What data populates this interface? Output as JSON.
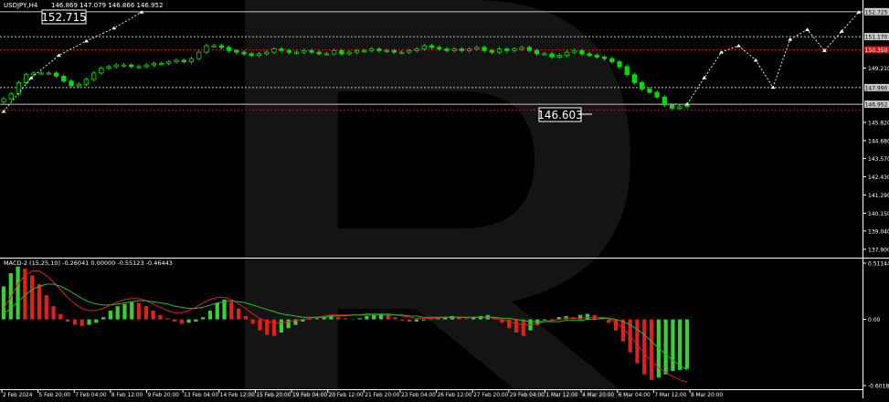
{
  "header": {
    "symbol": "USDJPY,H4",
    "ohlc": "146.869 147.079 146.866 146.952",
    "macd_label": "MACD-2 (15,25,10) -0.26041 0.00000 -0.55123 -0.46443"
  },
  "watermark": "R",
  "colors": {
    "background": "#000000",
    "candle": "#00e000",
    "hist_up": "#38d038",
    "hist_down": "#e02020",
    "macd_line": "#e02020",
    "signal_line": "#20c020",
    "level_white": "#c8c8c8",
    "level_red": "#d01010",
    "forecast": "#ffffff"
  },
  "callouts": {
    "high": "152.715",
    "current": "146.603"
  },
  "chart_data": [
    {
      "type": "line",
      "title": "USDJPY,H4",
      "ylim": [
        137.49,
        153.0
      ],
      "x_ticks": [
        "2 Feb 2024",
        "5 Feb 20:00",
        "7 Feb 04:00",
        "8 Feb 12:00",
        "9 Feb 20:00",
        "13 Feb 04:00",
        "14 Feb 12:00",
        "15 Feb 20:00",
        "19 Feb 04:00",
        "20 Feb 12:00",
        "21 Feb 20:00",
        "23 Feb 04:00",
        "26 Feb 12:00",
        "27 Feb 20:00",
        "29 Feb 04:00",
        "1 Mar 12:00",
        "4 Mar 20:00",
        "6 Mar 04:00",
        "7 Mar 12:00",
        "8 Mar 20:00"
      ],
      "y_ticks": [
        "152.725",
        "151.170",
        "150.350",
        "149.210",
        "147.990",
        "146.952",
        "145.820",
        "144.680",
        "143.570",
        "142.430",
        "141.290",
        "140.150",
        "139.040",
        "137.900"
      ],
      "price_series": [
        147.3,
        147.6,
        148.3,
        148.8,
        148.9,
        148.9,
        148.9,
        148.7,
        148.4,
        148.1,
        148.2,
        148.5,
        148.9,
        149.2,
        149.3,
        149.4,
        149.4,
        149.3,
        149.3,
        149.4,
        149.5,
        149.5,
        149.6,
        149.7,
        149.6,
        149.8,
        150.2,
        150.6,
        150.6,
        150.5,
        150.3,
        150.2,
        150.1,
        150.0,
        150.1,
        150.2,
        150.4,
        150.3,
        150.2,
        150.2,
        150.3,
        150.2,
        150.1,
        150.1,
        150.3,
        150.1,
        150.2,
        150.3,
        150.3,
        150.4,
        150.3,
        150.3,
        150.2,
        150.2,
        150.3,
        150.4,
        150.6,
        150.5,
        150.4,
        150.3,
        150.4,
        150.3,
        150.4,
        150.5,
        150.3,
        150.2,
        150.4,
        150.3,
        150.4,
        150.5,
        150.3,
        150.1,
        150.1,
        149.9,
        150.0,
        150.2,
        150.3,
        150.1,
        150.0,
        149.9,
        149.8,
        149.6,
        149.3,
        148.8,
        148.3,
        147.9,
        147.7,
        147.4,
        146.9,
        146.7,
        146.8,
        146.95
      ],
      "levels": [
        {
          "value": 152.725,
          "label": "152.725",
          "color": "white"
        },
        {
          "value": 151.17,
          "label": "151.170",
          "color": "white"
        },
        {
          "value": 150.35,
          "label": "150.350",
          "color": "red"
        },
        {
          "value": 147.99,
          "label": "147.990",
          "color": "white"
        },
        {
          "value": 146.952,
          "label": "146.952",
          "color": "white"
        },
        {
          "value": 146.603,
          "label": "146.603",
          "color": "red"
        }
      ],
      "forecast_path": [
        [
          0,
          146.95
        ],
        [
          1,
          148.6
        ],
        [
          2,
          150.2
        ],
        [
          3,
          150.6
        ],
        [
          4,
          149.7
        ],
        [
          5,
          148.0
        ],
        [
          6,
          151.0
        ],
        [
          7,
          151.6
        ],
        [
          8,
          150.3
        ],
        [
          9,
          151.5
        ],
        [
          10,
          152.7
        ]
      ],
      "forecast_history": [
        [
          0,
          146.5
        ],
        [
          1,
          148.6
        ],
        [
          2,
          150.0
        ],
        [
          3,
          150.9
        ],
        [
          4,
          151.7
        ],
        [
          5,
          152.7
        ]
      ]
    },
    {
      "type": "bar",
      "title": "MACD-2 (15,25,10)",
      "ylim": [
        -0.60184,
        0.51144
      ],
      "y_ticks": [
        "0.51144",
        "0.00",
        "-0.60184"
      ],
      "histogram": [
        0.3,
        0.42,
        0.48,
        0.46,
        0.4,
        0.32,
        0.22,
        0.12,
        0.05,
        -0.02,
        -0.05,
        -0.06,
        -0.05,
        -0.03,
        0.02,
        0.08,
        0.12,
        0.14,
        0.16,
        0.15,
        0.12,
        0.08,
        0.04,
        0.01,
        -0.02,
        -0.04,
        -0.03,
        -0.02,
        0.02,
        0.08,
        0.15,
        0.18,
        0.16,
        0.1,
        0.03,
        -0.04,
        -0.1,
        -0.14,
        -0.15,
        -0.12,
        -0.08,
        -0.05,
        -0.02,
        0.0,
        0.01,
        0.02,
        0.03,
        0.02,
        0.01,
        0.0,
        0.01,
        0.03,
        0.04,
        0.05,
        0.04,
        0.02,
        -0.01,
        -0.02,
        -0.02,
        -0.01,
        0.0,
        0.01,
        0.02,
        0.03,
        0.02,
        0.01,
        0.02,
        0.03,
        0.04,
        0.02,
        -0.03,
        -0.08,
        -0.12,
        -0.15,
        -0.1,
        -0.05,
        -0.01,
        0.0,
        0.02,
        0.03,
        0.02,
        0.04,
        0.05,
        0.04,
        0.02,
        -0.03,
        -0.1,
        -0.2,
        -0.3,
        -0.4,
        -0.5,
        -0.55,
        -0.53,
        -0.5,
        -0.47,
        -0.46,
        -0.45
      ],
      "macd_line": [
        0.1,
        0.2,
        0.32,
        0.4,
        0.44,
        0.44,
        0.4,
        0.34,
        0.27,
        0.2,
        0.14,
        0.1,
        0.08,
        0.08,
        0.1,
        0.13,
        0.16,
        0.18,
        0.19,
        0.19,
        0.17,
        0.14,
        0.11,
        0.08,
        0.06,
        0.06,
        0.08,
        0.11,
        0.15,
        0.18,
        0.2,
        0.2,
        0.18,
        0.14,
        0.1,
        0.05,
        0.01,
        -0.02,
        -0.03,
        -0.03,
        -0.02,
        -0.01,
        0.0,
        0.01,
        0.02,
        0.03,
        0.04,
        0.04,
        0.04,
        0.04,
        0.04,
        0.05,
        0.05,
        0.05,
        0.05,
        0.04,
        0.03,
        0.02,
        0.01,
        0.01,
        0.01,
        0.01,
        0.02,
        0.02,
        0.02,
        0.02,
        0.02,
        0.02,
        0.02,
        0.01,
        0.0,
        -0.02,
        -0.04,
        -0.05,
        -0.05,
        -0.04,
        -0.02,
        -0.01,
        0.0,
        0.01,
        0.01,
        0.01,
        0.02,
        0.02,
        0.02,
        0.01,
        -0.03,
        -0.08,
        -0.15,
        -0.23,
        -0.31,
        -0.38,
        -0.44,
        -0.48,
        -0.52,
        -0.55,
        -0.57
      ],
      "signal_line": [
        0.05,
        0.1,
        0.16,
        0.22,
        0.27,
        0.3,
        0.32,
        0.32,
        0.3,
        0.27,
        0.23,
        0.19,
        0.16,
        0.14,
        0.13,
        0.13,
        0.14,
        0.15,
        0.16,
        0.17,
        0.17,
        0.16,
        0.15,
        0.14,
        0.12,
        0.11,
        0.1,
        0.1,
        0.11,
        0.13,
        0.15,
        0.16,
        0.17,
        0.16,
        0.15,
        0.13,
        0.11,
        0.09,
        0.07,
        0.05,
        0.04,
        0.03,
        0.02,
        0.02,
        0.02,
        0.02,
        0.03,
        0.03,
        0.03,
        0.04,
        0.04,
        0.04,
        0.04,
        0.04,
        0.04,
        0.04,
        0.04,
        0.03,
        0.03,
        0.02,
        0.02,
        0.02,
        0.02,
        0.02,
        0.02,
        0.02,
        0.02,
        0.02,
        0.02,
        0.02,
        0.01,
        0.01,
        0.0,
        -0.01,
        -0.02,
        -0.02,
        -0.02,
        -0.02,
        -0.02,
        -0.01,
        -0.01,
        -0.01,
        0.0,
        0.0,
        0.01,
        0.01,
        0.0,
        -0.02,
        -0.05,
        -0.09,
        -0.14,
        -0.2,
        -0.26,
        -0.32,
        -0.37,
        -0.42,
        -0.46
      ]
    }
  ]
}
